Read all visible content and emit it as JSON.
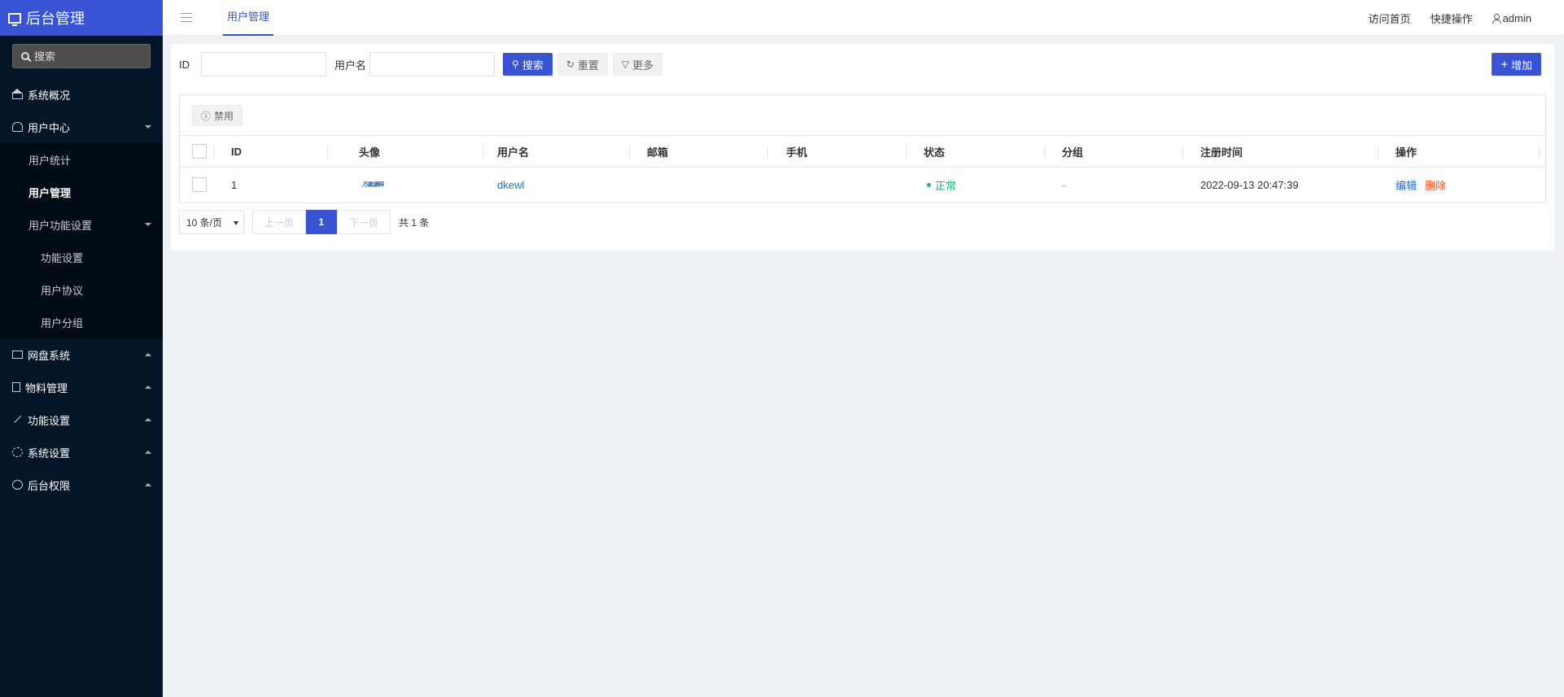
{
  "app": {
    "title": "后台管理"
  },
  "sidebar": {
    "search_placeholder": "搜索",
    "items": [
      {
        "label": "系统概况"
      },
      {
        "label": "用户中心"
      },
      {
        "label": "网盘系统"
      },
      {
        "label": "物料管理"
      },
      {
        "label": "功能设置"
      },
      {
        "label": "系统设置"
      },
      {
        "label": "后台权限"
      }
    ],
    "user_center_children": [
      {
        "label": "用户统计"
      },
      {
        "label": "用户管理"
      },
      {
        "label": "用户功能设置"
      }
    ],
    "user_feature_children": [
      {
        "label": "功能设置"
      },
      {
        "label": "用户协议"
      },
      {
        "label": "用户分组"
      }
    ]
  },
  "header": {
    "tab": "用户管理",
    "visit_home": "访问首页",
    "quick_ops": "快捷操作",
    "username": "admin"
  },
  "toolbar": {
    "id_label": "ID",
    "username_label": "用户名",
    "search": "搜索",
    "reset": "重置",
    "more": "更多",
    "add": "增加"
  },
  "table": {
    "disable_button": "禁用",
    "columns": [
      "ID",
      "头像",
      "用户名",
      "邮箱",
      "手机",
      "状态",
      "分组",
      "注册时间",
      "操作"
    ],
    "rows": [
      {
        "id": "1",
        "avatar_text": "万能源码",
        "username": "dkewl",
        "email": "",
        "phone": "",
        "status": "正常",
        "group": "-",
        "registered": "2022-09-13 20:47:39",
        "edit": "编辑",
        "delete": "删除"
      }
    ]
  },
  "pager": {
    "per_page": "10 条/页",
    "prev": "上一页",
    "current": "1",
    "next": "下一页",
    "total": "共 1 条"
  },
  "colors": {
    "primary": "#3853d4",
    "sidebar": "#041527",
    "success": "#16b777",
    "danger": "#ff5722",
    "link": "#1e6ed6"
  }
}
